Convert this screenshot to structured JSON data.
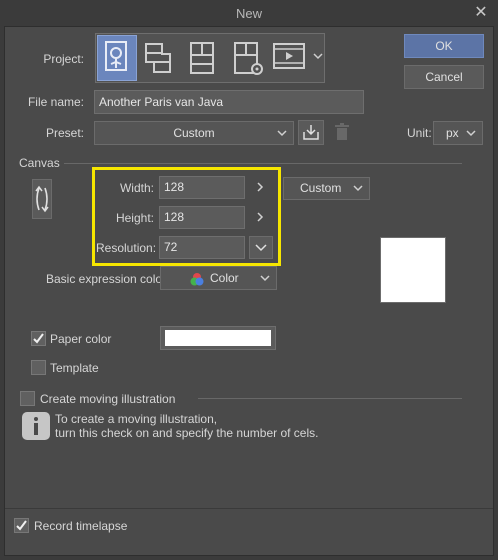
{
  "window": {
    "title": "New",
    "close_glyph": "✕"
  },
  "project": {
    "label": "Project:",
    "icons": [
      "illustration-icon",
      "webtoon-icon",
      "comic-icon",
      "comic-settings-icon",
      "animation-icon"
    ]
  },
  "file_name": {
    "label": "File name:",
    "value": "Another Paris van Java"
  },
  "preset": {
    "label": "Preset:",
    "value": "Custom"
  },
  "unit": {
    "label": "Unit:",
    "value": "px"
  },
  "buttons": {
    "ok": "OK",
    "cancel": "Cancel"
  },
  "canvas": {
    "section_label": "Canvas",
    "width_label": "Width:",
    "width_value": "128",
    "height_label": "Height:",
    "height_value": "128",
    "resolution_label": "Resolution:",
    "resolution_value": "72",
    "size_preset": "Custom",
    "expression_label": "Basic expression color:",
    "expression_value": "Color",
    "paper_color_label": "Paper color",
    "template_label": "Template"
  },
  "moving": {
    "label": "Create moving illustration",
    "info_line1": "To create a moving illustration,",
    "info_line2": "turn this check on and specify the number of cels."
  },
  "timelapse": {
    "label": "Record timelapse"
  },
  "colors": {
    "accent": "#5c74a6",
    "highlight": "#f6e600",
    "panel": "#4a4a4a"
  }
}
